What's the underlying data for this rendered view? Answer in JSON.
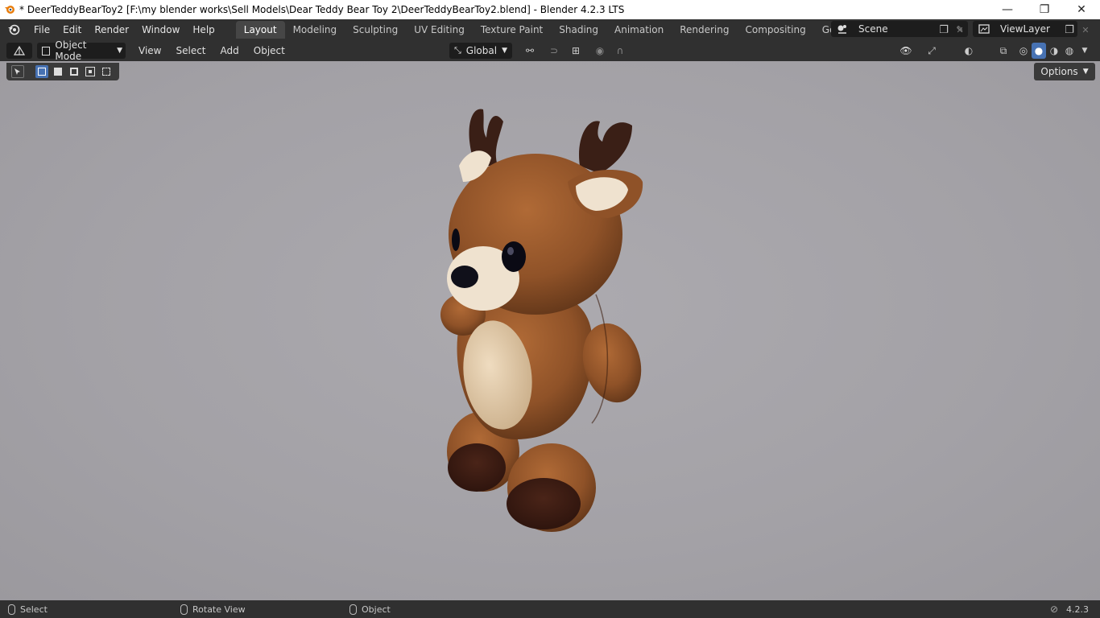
{
  "window": {
    "title": "* DeerTeddyBearToy2 [F:\\my blender works\\Sell Models\\Dear Teddy Bear Toy 2\\DeerTeddyBearToy2.blend] - Blender 4.2.3 LTS",
    "minimize": "—",
    "restore": "❐",
    "close": "✕"
  },
  "menu": {
    "items": [
      "File",
      "Edit",
      "Render",
      "Window",
      "Help"
    ],
    "tabs": [
      "Layout",
      "Modeling",
      "Sculpting",
      "UV Editing",
      "Texture Paint",
      "Shading",
      "Animation",
      "Rendering",
      "Compositing",
      "Geometry Nodes"
    ],
    "active_tab": "Layout",
    "scene": "Scene",
    "view_layer": "ViewLayer"
  },
  "header": {
    "mode": "Object Mode",
    "menus": [
      "View",
      "Select",
      "Add",
      "Object"
    ],
    "transform_orientation": "Global"
  },
  "viewport": {
    "options_label": "Options"
  },
  "statusbar": {
    "select": "Select",
    "rotate": "Rotate View",
    "object": "Object",
    "version": "4.2.3"
  },
  "colors": {
    "accent": "#4772b3",
    "panel": "#303030",
    "viewport_bg": "#a6a4a9"
  }
}
